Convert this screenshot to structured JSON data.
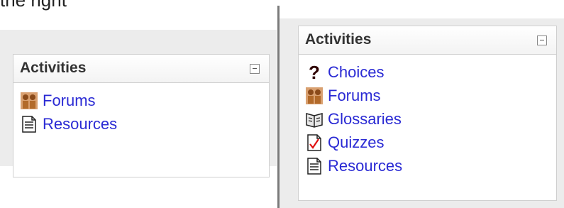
{
  "caption": "the right",
  "left_block": {
    "title": "Activities",
    "items": [
      {
        "label": "Forums",
        "icon": "forum-icon"
      },
      {
        "label": "Resources",
        "icon": "resource-icon"
      }
    ]
  },
  "right_block": {
    "title": "Activities",
    "items": [
      {
        "label": "Choices",
        "icon": "choice-icon"
      },
      {
        "label": "Forums",
        "icon": "forum-icon"
      },
      {
        "label": "Glossaries",
        "icon": "glossary-icon"
      },
      {
        "label": "Quizzes",
        "icon": "quiz-icon"
      },
      {
        "label": "Resources",
        "icon": "resource-icon"
      }
    ]
  },
  "colors": {
    "link": "#2a2ad4",
    "panel_background": "#ececec",
    "divider": "#7a7a7a"
  }
}
